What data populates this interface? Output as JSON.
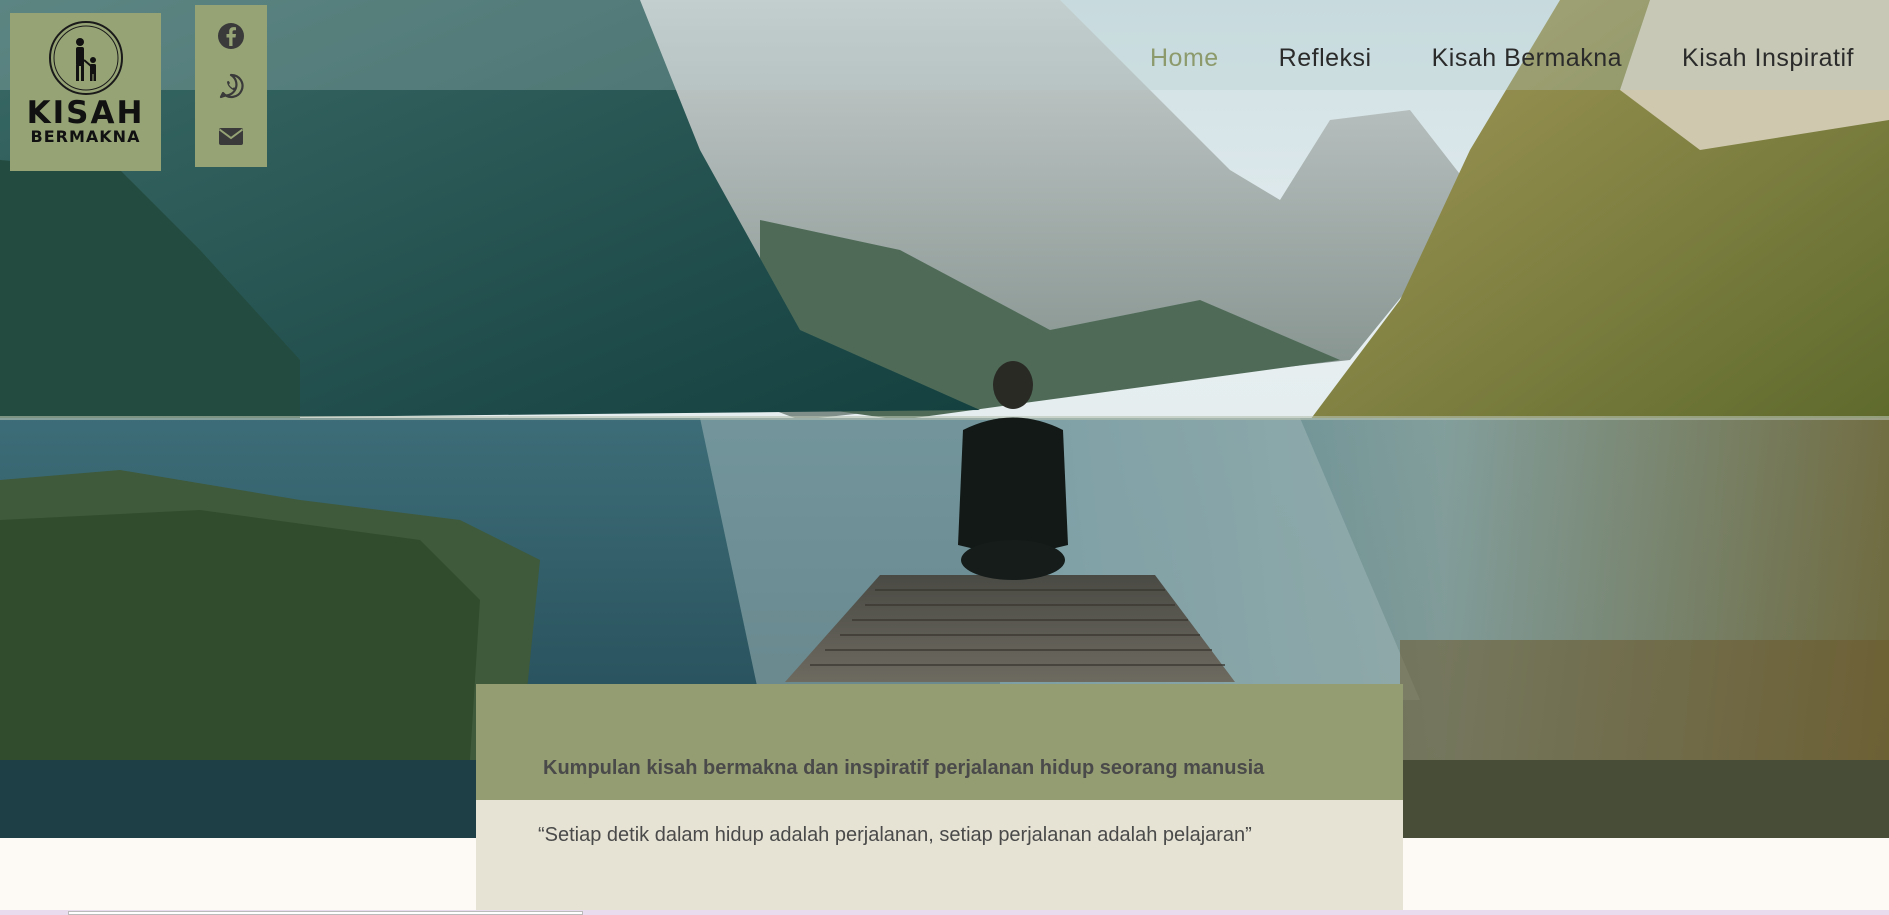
{
  "logo": {
    "title": "KISAH",
    "subtitle": "BERMAKNA",
    "icon": "parent-child-silhouette-icon"
  },
  "social": [
    {
      "name": "facebook",
      "icon": "facebook-icon"
    },
    {
      "name": "whatsapp",
      "icon": "whatsapp-icon"
    },
    {
      "name": "email",
      "icon": "envelope-icon"
    }
  ],
  "nav": {
    "items": [
      {
        "label": "Home",
        "active": true
      },
      {
        "label": "Refleksi",
        "active": false
      },
      {
        "label": "Kisah Bermakna",
        "active": false
      },
      {
        "label": "Kisah Inspiratif",
        "active": false
      }
    ]
  },
  "hero": {
    "tagline": "Kumpulan kisah bermakna dan inspiratif perjalanan hidup seorang manusia",
    "quote": "“Setiap detik dalam hidup adalah perjalanan, setiap perjalanan adalah pelajaran”"
  },
  "colors": {
    "accent_green": "#96a475",
    "card_green": "#949d72",
    "card_cream": "#e6e3d4",
    "nav_active": "#8c9a6c",
    "page_bg": "#fdf9f5"
  }
}
